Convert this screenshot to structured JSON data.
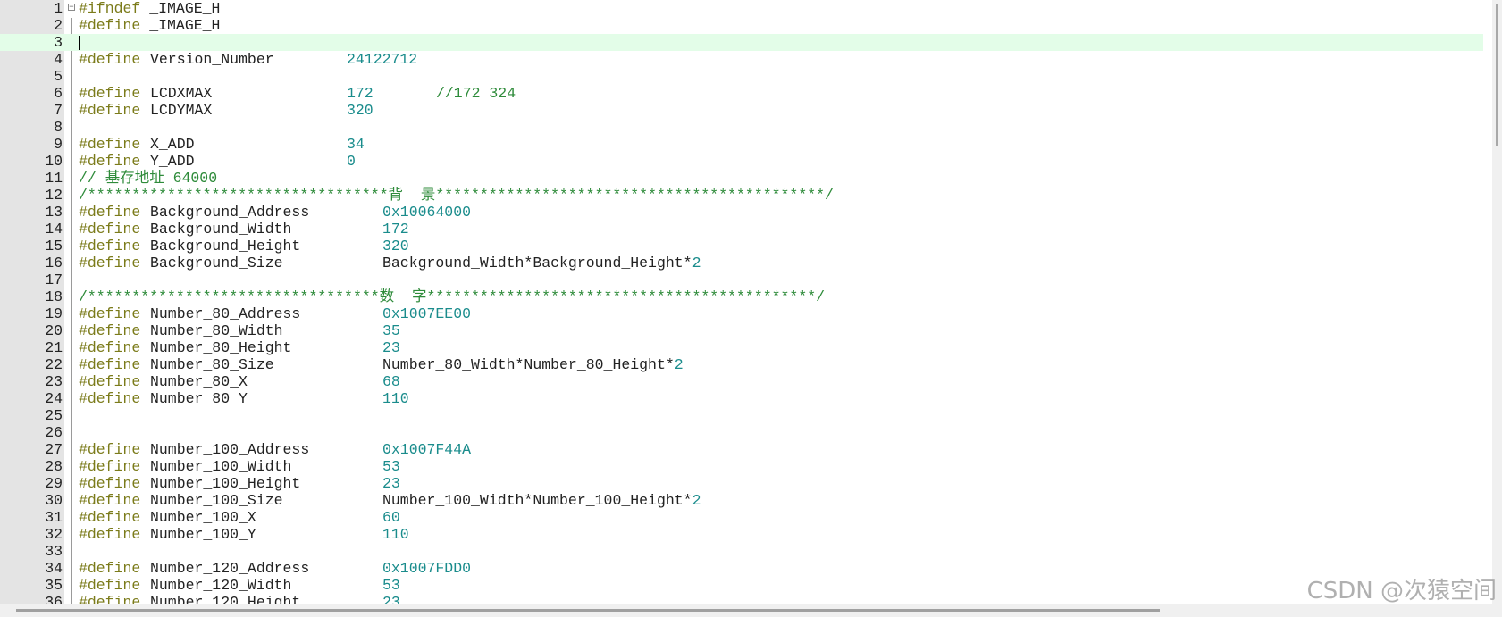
{
  "colors": {
    "keyword": "#7b7b1a",
    "number": "#1a8c8c",
    "comment": "#2e8b3a",
    "current_line": "#e3fde8",
    "gutter": "#e4e4e4"
  },
  "icons": {
    "fold": "minus-box-icon"
  },
  "watermark": "CSDN @次猿空间",
  "current_line": 3,
  "lines": [
    {
      "n": "1",
      "kind": "raw",
      "parts": [
        {
          "c": "kw",
          "t": "#ifndef "
        },
        {
          "c": "id",
          "t": "_IMAGE_H"
        }
      ]
    },
    {
      "n": "2",
      "kind": "raw",
      "parts": [
        {
          "c": "kw",
          "t": "#define "
        },
        {
          "c": "id",
          "t": "_IMAGE_H"
        }
      ]
    },
    {
      "n": "3",
      "kind": "blank"
    },
    {
      "n": "4",
      "kind": "def",
      "name": "Version_Number",
      "val": "24122712",
      "vcol": "short"
    },
    {
      "n": "5",
      "kind": "blank"
    },
    {
      "n": "6",
      "kind": "def",
      "name": "LCDXMAX",
      "val": "172",
      "vcol": "short",
      "comment": "//172 324"
    },
    {
      "n": "7",
      "kind": "def",
      "name": "LCDYMAX",
      "val": "320",
      "vcol": "short"
    },
    {
      "n": "8",
      "kind": "blank"
    },
    {
      "n": "9",
      "kind": "def",
      "name": "X_ADD",
      "val": "34",
      "vcol": "short"
    },
    {
      "n": "10",
      "kind": "def",
      "name": "Y_ADD",
      "val": "0",
      "vcol": "short"
    },
    {
      "n": "11",
      "kind": "raw",
      "parts": [
        {
          "c": "cmt",
          "t": "// 基存地址 64000"
        }
      ]
    },
    {
      "n": "12",
      "kind": "raw",
      "parts": [
        {
          "c": "cmt",
          "t": "/**********************************背  景********************************************/"
        }
      ]
    },
    {
      "n": "13",
      "kind": "def",
      "name": "Background_Address",
      "val": "0x10064000"
    },
    {
      "n": "14",
      "kind": "def",
      "name": "Background_Width",
      "val": "172"
    },
    {
      "n": "15",
      "kind": "def",
      "name": "Background_Height",
      "val": "320"
    },
    {
      "n": "16",
      "kind": "def",
      "name": "Background_Size",
      "expr": "Background_Width*Background_Height*",
      "tail": "2"
    },
    {
      "n": "17",
      "kind": "blank"
    },
    {
      "n": "18",
      "kind": "raw",
      "parts": [
        {
          "c": "cmt",
          "t": "/*********************************数  字********************************************/"
        }
      ]
    },
    {
      "n": "19",
      "kind": "def",
      "name": "Number_80_Address",
      "val": "0x1007EE00"
    },
    {
      "n": "20",
      "kind": "def",
      "name": "Number_80_Width",
      "val": "35"
    },
    {
      "n": "21",
      "kind": "def",
      "name": "Number_80_Height",
      "val": "23"
    },
    {
      "n": "22",
      "kind": "def",
      "name": "Number_80_Size",
      "expr": "Number_80_Width*Number_80_Height*",
      "tail": "2"
    },
    {
      "n": "23",
      "kind": "def",
      "name": "Number_80_X",
      "val": "68"
    },
    {
      "n": "24",
      "kind": "def",
      "name": "Number_80_Y",
      "val": "110"
    },
    {
      "n": "25",
      "kind": "blank"
    },
    {
      "n": "26",
      "kind": "blank"
    },
    {
      "n": "27",
      "kind": "def",
      "name": "Number_100_Address",
      "val": "0x1007F44A"
    },
    {
      "n": "28",
      "kind": "def",
      "name": "Number_100_Width",
      "val": "53"
    },
    {
      "n": "29",
      "kind": "def",
      "name": "Number_100_Height",
      "val": "23"
    },
    {
      "n": "30",
      "kind": "def",
      "name": "Number_100_Size",
      "expr": "Number_100_Width*Number_100_Height*",
      "tail": "2"
    },
    {
      "n": "31",
      "kind": "def",
      "name": "Number_100_X",
      "val": "60"
    },
    {
      "n": "32",
      "kind": "def",
      "name": "Number_100_Y",
      "val": "110"
    },
    {
      "n": "33",
      "kind": "blank"
    },
    {
      "n": "34",
      "kind": "def",
      "name": "Number_120_Address",
      "val": "0x1007FDD0"
    },
    {
      "n": "35",
      "kind": "def",
      "name": "Number_120_Width",
      "val": "53"
    },
    {
      "n": "36",
      "kind": "def",
      "name": "Number_120_Height",
      "val": "23"
    }
  ]
}
